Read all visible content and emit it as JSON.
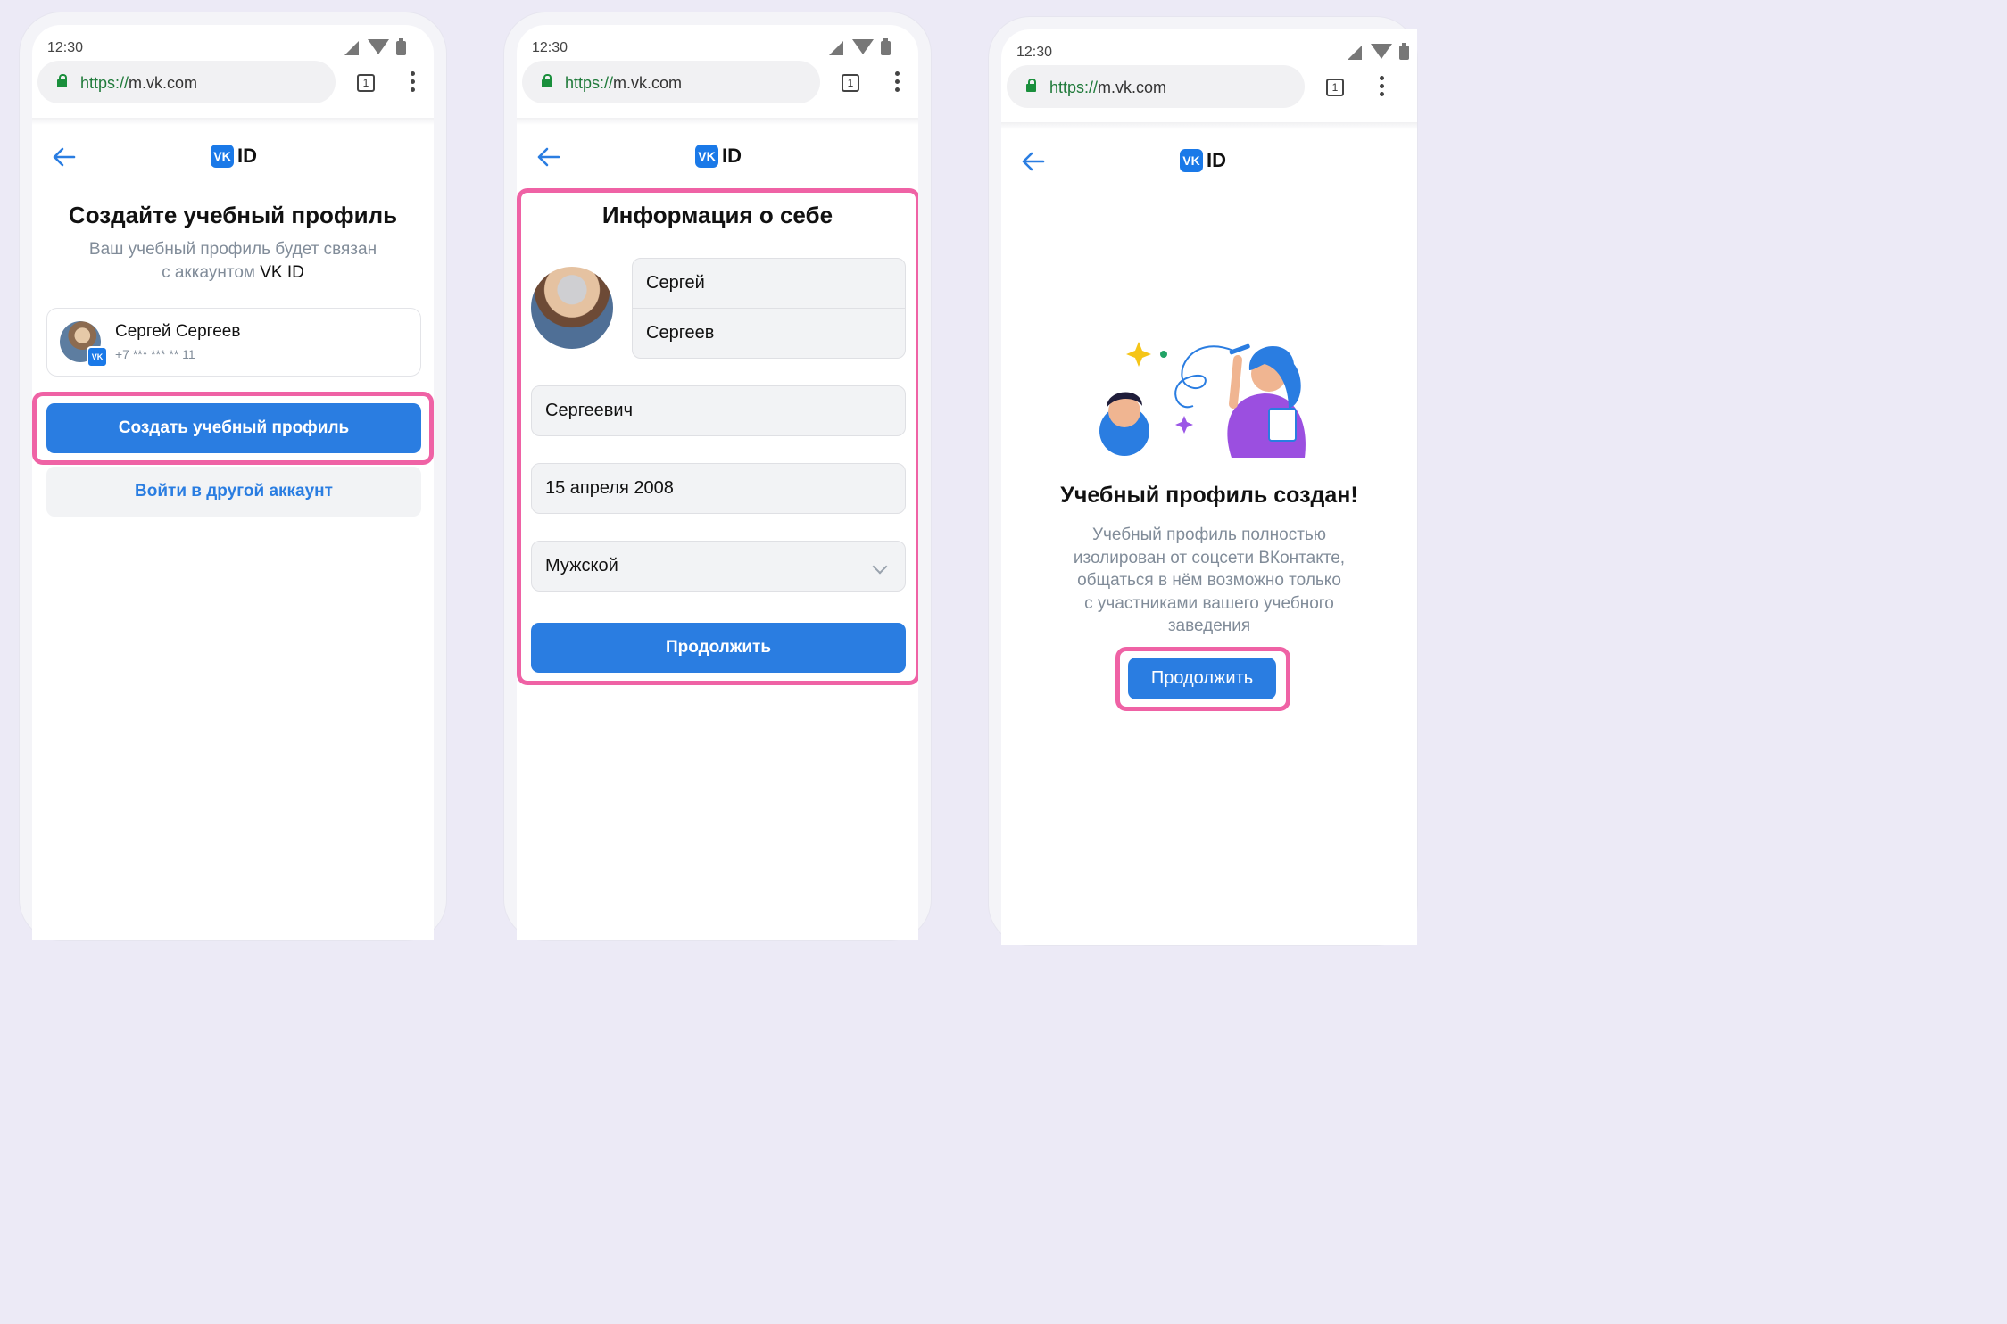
{
  "browser": {
    "time": "12:30",
    "url_proto": "https://",
    "url_host": "m.vk.com",
    "tab_count": "1"
  },
  "brand": {
    "logo_mark": "VK",
    "logo_text": "ID",
    "color": "#1a79e8"
  },
  "accent": {
    "primary": "#2a7de1",
    "highlight": "#ef62a5"
  },
  "screen1": {
    "title": "Создайте учебный профиль",
    "subtitle_line1": "Ваш учебный профиль будет связан",
    "subtitle_line2_prefix": "с аккаунтом ",
    "subtitle_line2_brand": "VK ID",
    "account_name": "Сергей Сергеев",
    "account_phone": "+7 *** *** ** 11",
    "create_button": "Создать учебный профиль",
    "other_account_button": "Войти в другой аккаунт"
  },
  "screen2": {
    "title": "Информация о себе",
    "first_name": "Сергей",
    "last_name": "Сергеев",
    "patronymic": "Сергеевич",
    "birth_date": "15 апреля 2008",
    "gender": "Мужской",
    "continue_button": "Продолжить"
  },
  "screen3": {
    "title": "Учебный профиль создан!",
    "description_lines": [
      "Учебный профиль полностью",
      "изолирован от соцсети ВКонтакте,",
      "общаться в нём возможно только",
      "с участниками вашего учебного",
      "заведения"
    ],
    "continue_button": "Продолжить"
  },
  "icons": [
    "lock-icon",
    "tabs-icon",
    "more-icon",
    "back-arrow-icon",
    "chevron-down-icon",
    "vk-badge-icon"
  ]
}
